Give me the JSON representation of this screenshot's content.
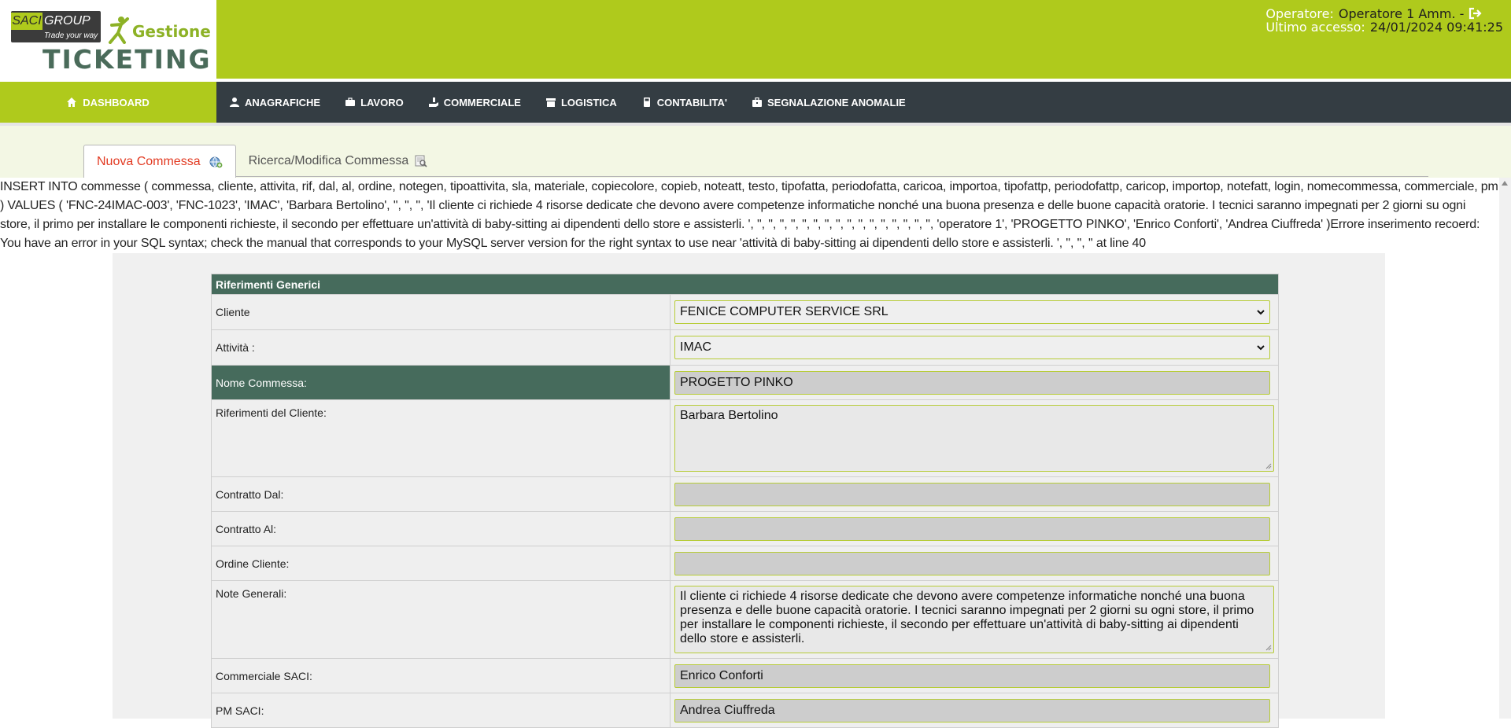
{
  "header": {
    "logo": {
      "brand_left": "SACI",
      "brand_right": "GROUP",
      "tagline": "Trade your way",
      "gestione": "Gestione",
      "app_name": "TICKETING"
    },
    "operator_label": "Operatore:",
    "operator_name": "Operatore 1 Amm. -",
    "last_access_label": "Ultimo accesso:",
    "last_access_value": "24/01/2024 09:41:25"
  },
  "nav": {
    "dashboard": "DASHBOARD",
    "items": [
      {
        "label": "ANAGRAFICHE",
        "icon": "user-icon"
      },
      {
        "label": "LAVORO",
        "icon": "briefcase-icon"
      },
      {
        "label": "COMMERCIALE",
        "icon": "hand-icon"
      },
      {
        "label": "LOGISTICA",
        "icon": "box-icon"
      },
      {
        "label": "CONTABILITA'",
        "icon": "calculator-icon"
      },
      {
        "label": "SEGNALAZIONE ANOMALIE",
        "icon": "toolbox-icon"
      }
    ]
  },
  "tabs": {
    "active": "Nuova Commessa",
    "other": "Ricerca/Modifica Commessa"
  },
  "sql_error": "INSERT INTO commesse ( commessa, cliente, attivita, rif, dal, al, ordine, notegen, tipoattivita, sla, materiale, copiecolore, copieb, noteatt, testo, tipofatta, periodofatta, caricoa, importoa, tipofattp, periodofattp, caricop, importop, notefatt, login, nomecommessa, commerciale, pm ) VALUES ( 'FNC-24IMAC-003', 'FNC-1023', 'IMAC', 'Barbara Bertolino', '', '', '', 'Il cliente ci richiede 4 risorse dedicate che devono avere competenze informatiche nonché una buona presenza e delle buone capacità oratorie. I tecnici saranno impegnati per 2 giorni su ogni store, il primo per installare le componenti richieste, il secondo per effettuare un'attività di baby-sitting ai dipendenti dello store e assisterli. ', '', '', '', '', '', '', '', '', '', '', '', '', '', '', '', '', 'operatore 1', 'PROGETTO PINKO', 'Enrico Conforti', 'Andrea Ciuffreda' )Errore inserimento recoerd: You have an error in your SQL syntax; check the manual that corresponds to your MySQL server version for the right syntax to use near 'attività di baby-sitting ai dipendenti dello store e assisterli. ', '', '', '' at line 40",
  "form": {
    "section_title": "Riferimenti Generici",
    "rows": {
      "cliente": {
        "label": "Cliente",
        "value": "FENICE COMPUTER SERVICE SRL"
      },
      "attivita": {
        "label": "Attività :",
        "value": "IMAC"
      },
      "nome_commessa": {
        "label": "Nome Commessa:",
        "value": "PROGETTO PINKO"
      },
      "riferimenti": {
        "label": "Riferimenti del Cliente:",
        "value": "Barbara Bertolino"
      },
      "contratto_dal": {
        "label": "Contratto Dal:",
        "value": ""
      },
      "contratto_al": {
        "label": "Contratto Al:",
        "value": ""
      },
      "ordine": {
        "label": "Ordine Cliente:",
        "value": ""
      },
      "note": {
        "label": "Note Generali:",
        "value": "Il cliente ci richiede 4 risorse dedicate che devono avere competenze informatiche nonché una buona presenza e delle buone capacità oratorie. I tecnici saranno impegnati per 2 giorni su ogni store, il primo per installare le componenti richieste, il secondo per effettuare un'attività di baby-sitting ai dipendenti dello store e assisterli."
      },
      "commerciale": {
        "label": "Commerciale SACI:",
        "value": "Enrico Conforti"
      },
      "pm": {
        "label": "PM SACI:",
        "value": "Andrea Ciuffreda"
      }
    }
  },
  "colors": {
    "brand_green": "#afca1c",
    "nav_dark": "#343d43",
    "table_header": "#466b5c",
    "tab_active_text": "#e23a22"
  }
}
